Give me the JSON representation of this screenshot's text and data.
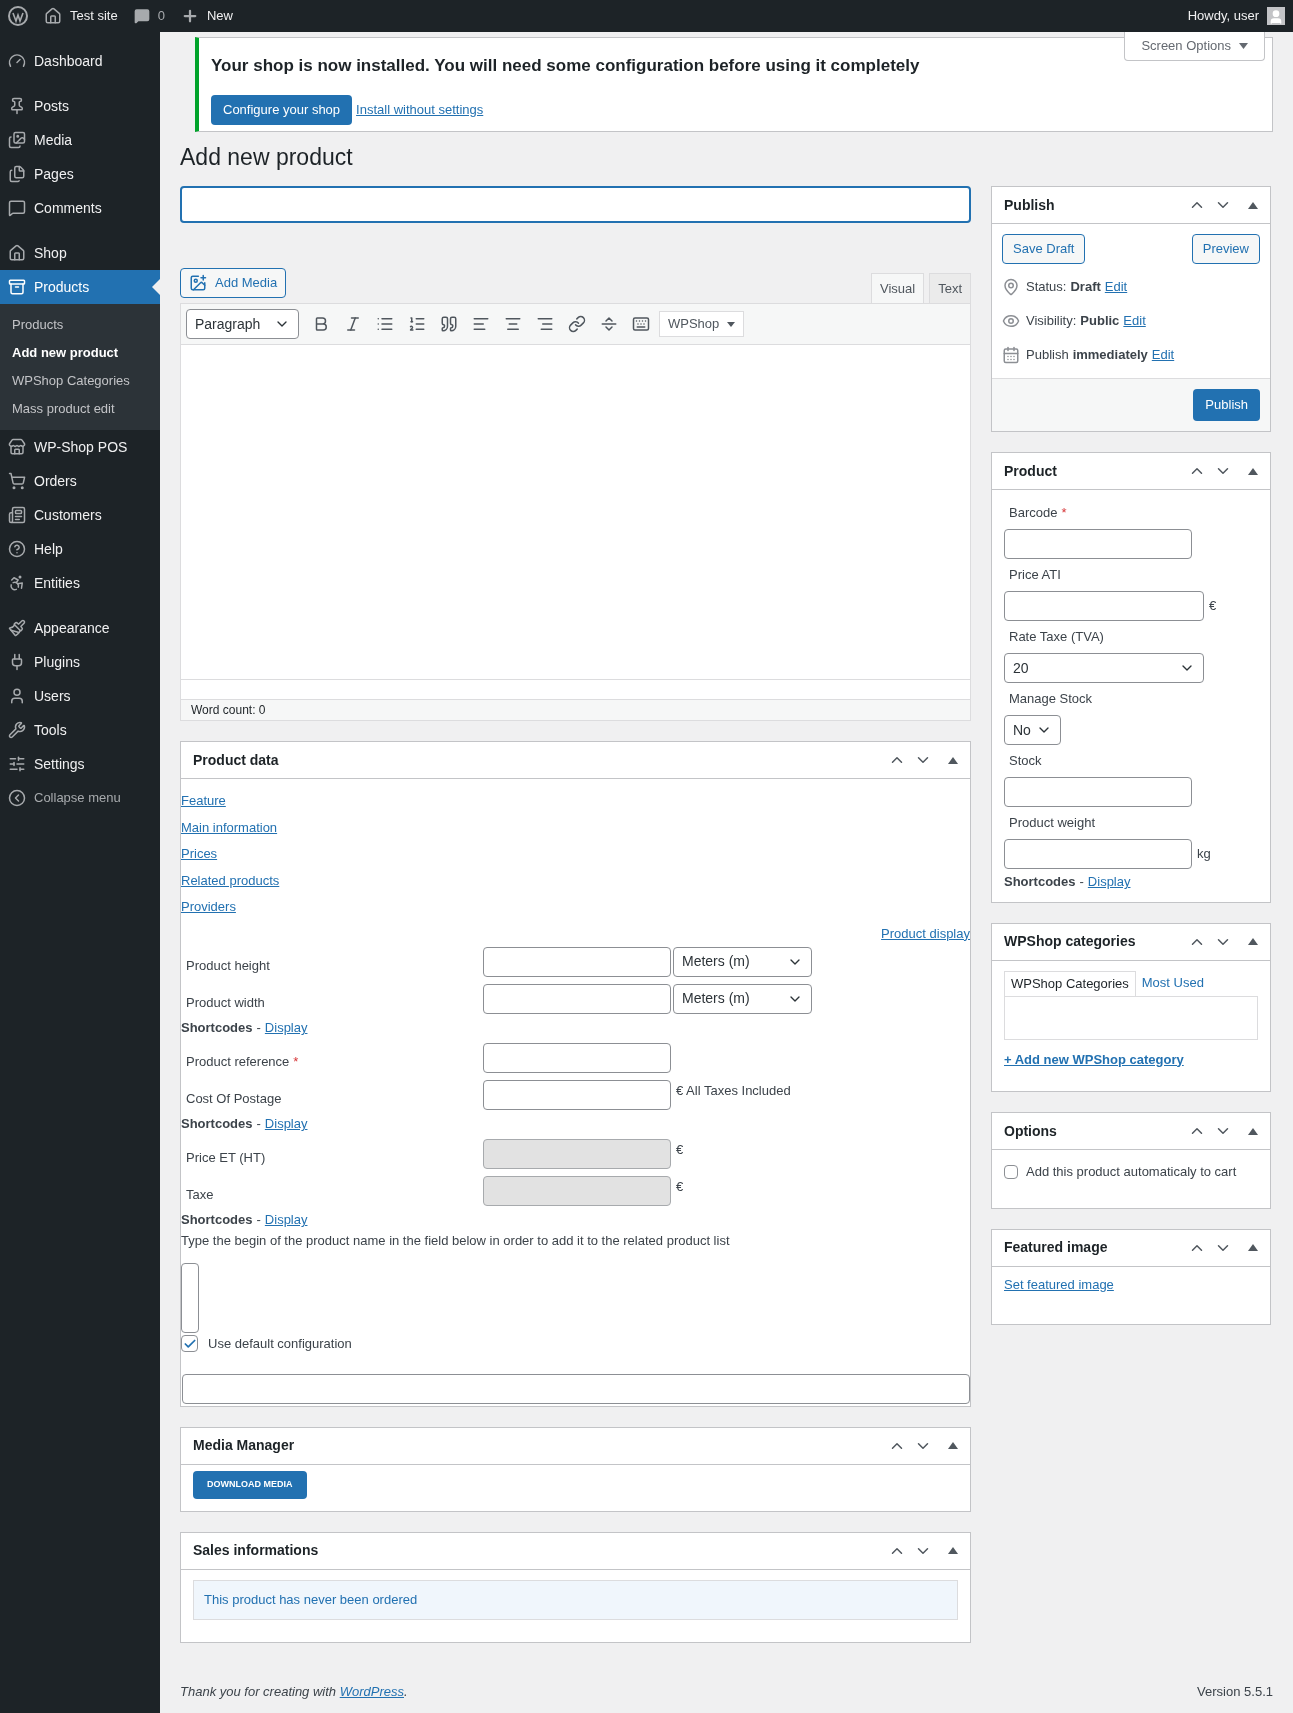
{
  "admin_bar": {
    "site": "Test site",
    "comments": "0",
    "new": "New",
    "greeting": "Howdy, user"
  },
  "screen_options": "Screen Options",
  "sidebar": {
    "items": [
      {
        "label": "Dashboard",
        "selected": false
      },
      {
        "label": "Posts",
        "selected": false
      },
      {
        "label": "Media",
        "selected": false
      },
      {
        "label": "Pages",
        "selected": false
      },
      {
        "label": "Comments",
        "selected": false
      },
      {
        "label": "Shop",
        "selected": false
      },
      {
        "label": "Products",
        "selected": true,
        "children": [
          {
            "label": "Products",
            "selected": false
          },
          {
            "label": "Add new product",
            "selected": true
          },
          {
            "label": "WPShop Categories",
            "selected": false
          },
          {
            "label": "Mass product edit",
            "selected": false
          }
        ]
      },
      {
        "label": "WP-Shop POS",
        "selected": false
      },
      {
        "label": "Orders",
        "selected": false
      },
      {
        "label": "Customers",
        "selected": false
      },
      {
        "label": "Help",
        "selected": false
      },
      {
        "label": "Entities",
        "selected": false
      },
      {
        "label": "Appearance",
        "selected": false
      },
      {
        "label": "Plugins",
        "selected": false
      },
      {
        "label": "Users",
        "selected": false
      },
      {
        "label": "Tools",
        "selected": false
      },
      {
        "label": "Settings",
        "selected": false
      }
    ],
    "collapse": "Collapse menu"
  },
  "notice": {
    "message": "Your shop is now installed. You will need some configuration before using it completely",
    "button": "Configure your shop",
    "link": "Install without settings"
  },
  "page_title": "Add new product",
  "editor": {
    "add_media": "Add Media",
    "tabs": [
      {
        "label": "Visual",
        "selected": true
      },
      {
        "label": "Text",
        "selected": false
      }
    ],
    "format": "Paragraph",
    "wpshop": "WPShop",
    "word_count": "Word count: 0"
  },
  "product_data": {
    "title": "Product data",
    "links": [
      "Feature",
      "Main information",
      "Prices",
      "Related products",
      "Providers"
    ],
    "display_link": "Product display",
    "rows": [
      {
        "kind": "field",
        "label": "Product height",
        "disabled": false,
        "select": "Meters (m)"
      },
      {
        "kind": "field",
        "label": "Product width",
        "disabled": false,
        "select": "Meters (m)"
      },
      {
        "kind": "shortcodes",
        "label": "Shortcodes",
        "dash": "-",
        "link": "Display"
      },
      {
        "kind": "field",
        "label": "Product reference",
        "required_mark": "*",
        "disabled": false
      },
      {
        "kind": "field",
        "label": "Cost Of Postage",
        "disabled": false,
        "suffix": "€ All Taxes Included"
      },
      {
        "kind": "shortcodes",
        "label": "Shortcodes",
        "dash": "-",
        "link": "Display"
      },
      {
        "kind": "field",
        "label": "Price ET (HT)",
        "disabled": true,
        "suffix": "€"
      },
      {
        "kind": "field",
        "label": "Taxe",
        "disabled": true,
        "suffix": "€"
      },
      {
        "kind": "shortcodes",
        "label": "Shortcodes",
        "dash": "-",
        "link": "Display"
      },
      {
        "kind": "note",
        "text": "Type the begin of the product name in the field below in order to add it to the related product list"
      },
      {
        "kind": "textarea"
      },
      {
        "kind": "checkbox",
        "label": "Use default configuration",
        "checked": true
      },
      {
        "kind": "input"
      }
    ]
  },
  "media_manager": {
    "title": "Media Manager",
    "button": "DOWNLOAD MEDIA"
  },
  "sales": {
    "title": "Sales informations",
    "message": "This product has never been ordered"
  },
  "publish": {
    "title": "Publish",
    "save_draft": "Save Draft",
    "preview": "Preview",
    "meta": [
      {
        "label": "Status:",
        "value": "Draft",
        "link": "Edit"
      },
      {
        "label": "Visibility:",
        "value": "Public",
        "link": "Edit"
      },
      {
        "label": "Publish",
        "value": "immediately",
        "link": "Edit"
      }
    ],
    "button": "Publish"
  },
  "product": {
    "title": "Product",
    "fields": [
      {
        "kind": "input",
        "label": "Barcode",
        "required_mark": "*"
      },
      {
        "kind": "input",
        "label": "Price ATI",
        "suffix": "€"
      },
      {
        "kind": "select",
        "label": "Rate Taxe (TVA)",
        "value": "20"
      },
      {
        "kind": "select",
        "label": "Manage Stock",
        "value": "No"
      },
      {
        "kind": "input",
        "label": "Stock"
      },
      {
        "kind": "input",
        "label": "Product weight",
        "suffix": "kg"
      }
    ],
    "shortcodes": {
      "label": "Shortcodes",
      "dash": "-",
      "link": "Display"
    }
  },
  "categories": {
    "title": "WPShop categories",
    "tabs": [
      {
        "label": "WPShop Categories",
        "selected": true
      },
      {
        "label": "Most Used",
        "selected": false
      }
    ],
    "add_link": "+ Add new WPShop category"
  },
  "options": {
    "title": "Options",
    "checkbox": {
      "label": "Add this product automaticaly to cart",
      "checked": false
    }
  },
  "featured_image": {
    "title": "Featured image",
    "link": "Set featured image"
  },
  "footer": {
    "text": "Thank you for creating with",
    "link": "WordPress",
    "suffix": ".",
    "version": "Version 5.5.1"
  }
}
